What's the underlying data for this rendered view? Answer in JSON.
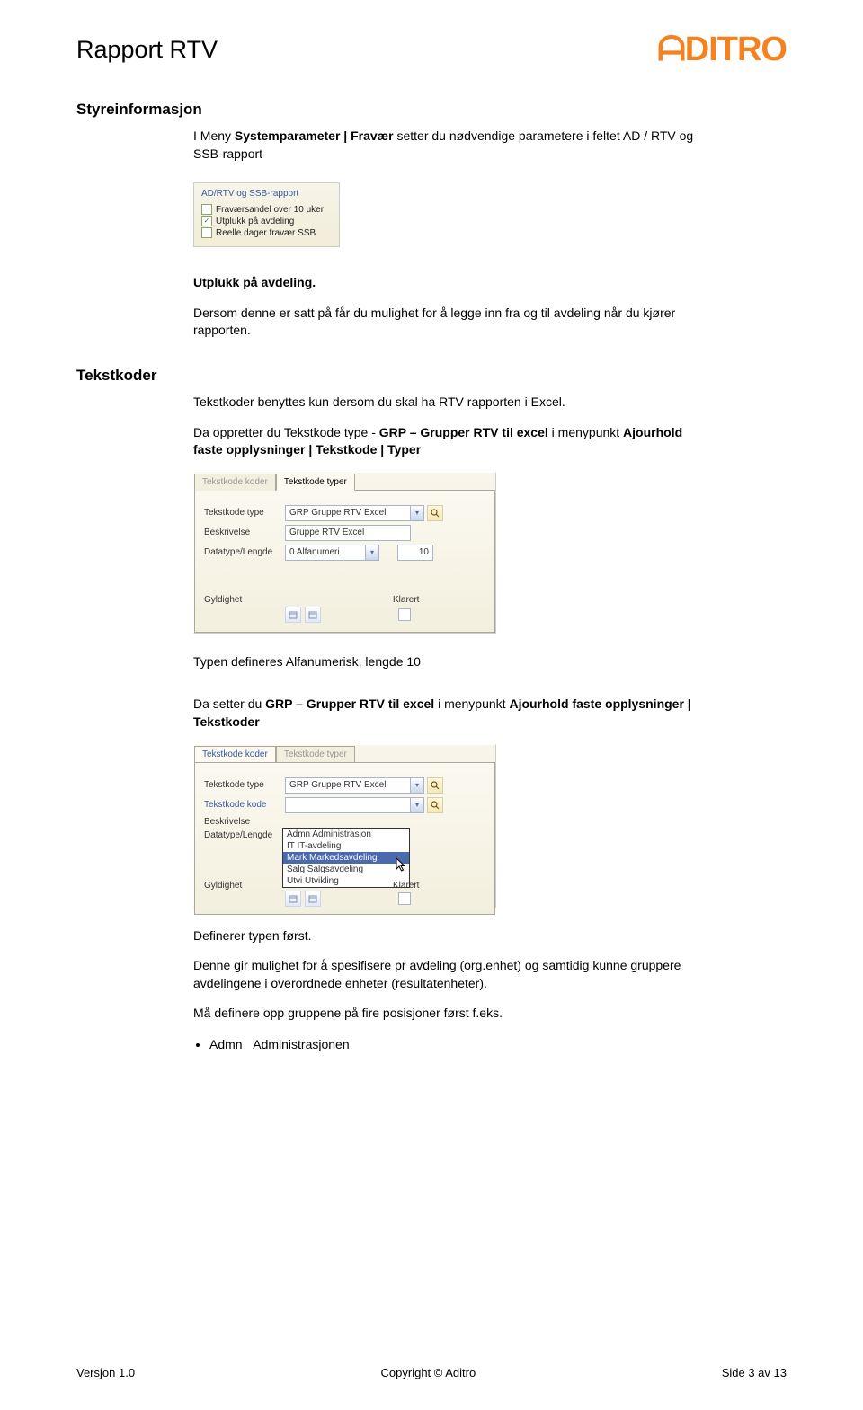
{
  "header": {
    "doc_title": "Rapport RTV",
    "logo_text": "ᗩDITRO"
  },
  "section1": {
    "heading": "Styreinformasjon",
    "p1_pre": "I Meny ",
    "p1_bold": "Systemparameter | Fravær",
    "p1_post": " setter du nødvendige parametere i feltet AD / RTV og SSB-rapport",
    "img_label": "AD/RTV og SSB-rapport",
    "cb1": "Fraværsandel over 10 uker",
    "cb2": "Utplukk på avdeling",
    "cb3": "Reelle dager fravær SSB",
    "p2_bold": "Utplukk på avdeling.",
    "p3": "Dersom denne er satt på får du mulighet for å legge inn fra og til avdeling når du kjører rapporten."
  },
  "section2": {
    "heading": "Tekstkoder",
    "p1": "Tekstkoder benyttes kun dersom du skal ha RTV rapporten i Excel.",
    "p2_a": "Da oppretter du Tekstkode type - ",
    "p2_b": "GRP – Grupper RTV til excel",
    "p2_c": " i menypunkt ",
    "p2_d": "Ajourhold faste opplysninger | Tekstkode | Typer",
    "panel1": {
      "tab1": "Tekstkode koder",
      "tab2": "Tekstkode typer",
      "label_type": "Tekstkode type",
      "val_type": "GRP Gruppe RTV Excel",
      "label_besk": "Beskrivelse",
      "val_besk": "Gruppe RTV Excel",
      "label_dt": "Datatype/Lengde",
      "val_dt": "0 Alfanumeri",
      "val_len": "10",
      "label_gyld": "Gyldighet",
      "label_klar": "Klarert"
    },
    "p3": "Typen defineres Alfanumerisk, lengde 10",
    "p4_a": "Da setter du ",
    "p4_b": "GRP – Grupper RTV til excel",
    "p4_c": " i menypunkt ",
    "p4_d": "Ajourhold faste opplysninger | Tekstkoder",
    "panel2": {
      "tab1": "Tekstkode koder",
      "tab2": "Tekstkode typer",
      "label_type": "Tekstkode type",
      "val_type": "GRP Gruppe RTV Excel",
      "label_kode": "Tekstkode kode",
      "val_kode": "",
      "label_besk": "Beskrivelse",
      "label_dt": "Datatype/Lengde",
      "dropdown": {
        "opt1": "Admn Administrasjon",
        "opt2": "IT IT-avdeling",
        "opt3": "Mark Markedsavdeling",
        "opt4": "Salg Salgsavdeling",
        "opt5": "Utvi Utvikling"
      },
      "label_gyld": "Gyldighet",
      "label_klar": "Klarert"
    },
    "p5": "Definerer typen først.",
    "p6": "Denne gir mulighet for å spesifisere pr avdeling (org.enhet) og samtidig kunne gruppere avdelingene i overordnede enheter (resultatenheter).",
    "p7": "Må definere opp gruppene på fire posisjoner først f.eks.",
    "bullet1": "Admn   Administrasjonen"
  },
  "footer": {
    "left": "Versjon 1.0",
    "center": "Copyright © Aditro",
    "right": "Side 3 av 13"
  }
}
